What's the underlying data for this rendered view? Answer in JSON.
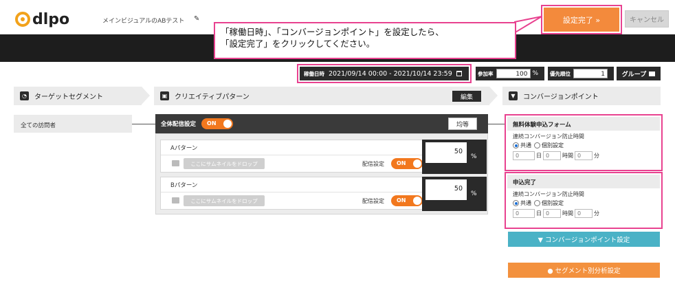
{
  "header": {
    "logo": "dlpo",
    "page_title": "メインビジュアルのABテスト",
    "complete_button": "設定完了 »",
    "cancel_button": "キャンセル"
  },
  "callout": {
    "line1": "「稼働日時」、「コンバージョンポイント」を設定したら、",
    "line2": "「設定完了」をクリックしてください。"
  },
  "settings": {
    "period_label": "稼働日時",
    "period_value": "2021/09/14 00:00 - 2021/10/14 23:59",
    "rate_label": "参加率",
    "rate_value": "100",
    "rate_unit": "%",
    "priority_label": "優先順位",
    "priority_value": "1",
    "group_button": "グループ"
  },
  "columns": {
    "target": "ターゲットセグメント",
    "creative": "クリエイティブパターン",
    "creative_edit": "編集",
    "conversion": "コンバージョンポイント"
  },
  "segment": {
    "item": "全ての訪問者"
  },
  "creative": {
    "all_label": "全体配信設定",
    "toggle_on": "ON",
    "equal_button": "均等",
    "drop_text": "ここにサムネイルをドロップ",
    "delivery_label": "配信設定",
    "unit": "%",
    "patterns": [
      {
        "name": "Aパターン",
        "percent": "50"
      },
      {
        "name": "Bパターン",
        "percent": "50"
      }
    ]
  },
  "conversion": {
    "points": [
      {
        "title": "無料体験申込フォーム",
        "sub": "連続コンバージョン防止時間",
        "opt_common": "共通",
        "opt_individual": "個別設定",
        "d": "0",
        "h": "0",
        "m": "0"
      },
      {
        "title": "申込完了",
        "sub": "連続コンバージョン防止時間",
        "opt_common": "共通",
        "opt_individual": "個別設定",
        "d": "0",
        "h": "0",
        "m": "0"
      }
    ],
    "day": "日",
    "hour": "時間",
    "min": "分",
    "cv_button": "▼ コンバージョンポイント設定",
    "seg_button": "● セグメント別分析設定"
  }
}
